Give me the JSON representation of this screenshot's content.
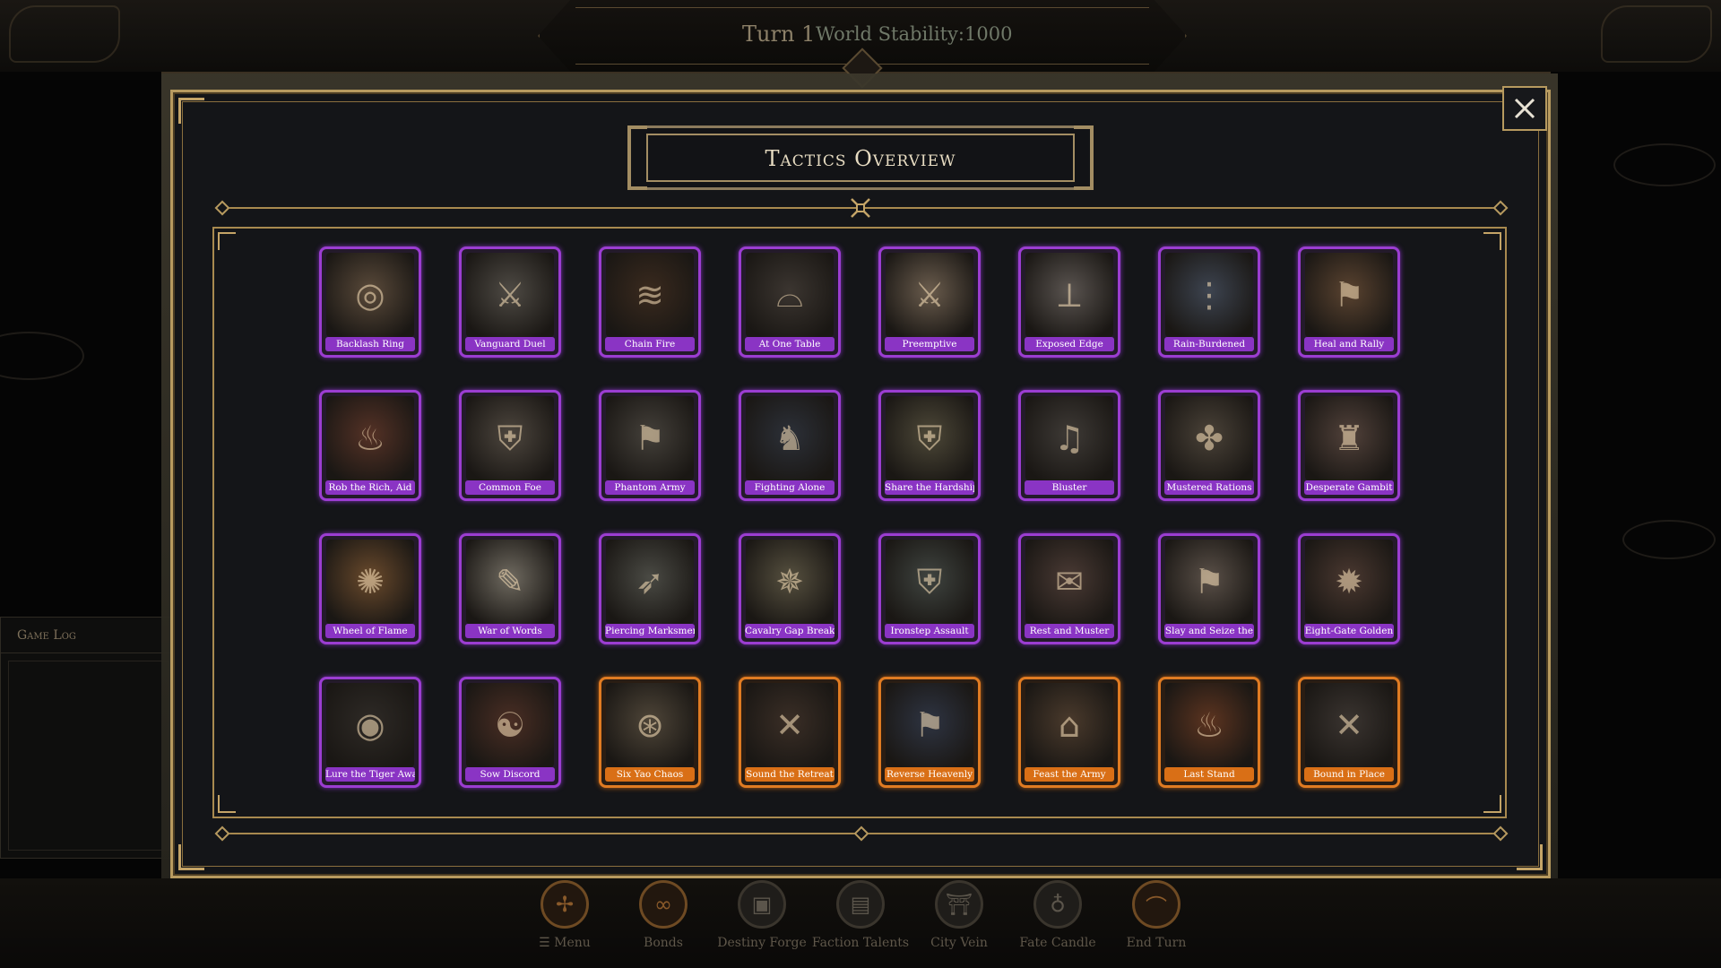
{
  "header": {
    "turn": "Turn 1",
    "stability": "World Stability:1000"
  },
  "game_log": {
    "title": "Game Log"
  },
  "modal": {
    "title": "Tactics Overview",
    "close_icon": "close-icon"
  },
  "colors": {
    "rare": "#9b3dd1",
    "legendary": "#e07b22",
    "gold": "#b79a5f"
  },
  "tactics": [
    {
      "label": "Backlash Ring",
      "rarity": "purple",
      "icon": "ring-icon",
      "glyph": "◎",
      "tone": "#5a4a3a"
    },
    {
      "label": "Vanguard Duel",
      "rarity": "purple",
      "icon": "swords-icon",
      "glyph": "⚔",
      "tone": "#4e4a44"
    },
    {
      "label": "Chain Fire",
      "rarity": "purple",
      "icon": "fire-chain-icon",
      "glyph": "≋",
      "tone": "#3a2a1e"
    },
    {
      "label": "At One Table",
      "rarity": "purple",
      "icon": "cauldron-icon",
      "glyph": "⌓",
      "tone": "#3b3530"
    },
    {
      "label": "Preemptive",
      "rarity": "purple",
      "icon": "strike-icon",
      "glyph": "⚔",
      "tone": "#6a5c4d"
    },
    {
      "label": "Exposed Edge",
      "rarity": "purple",
      "icon": "blade-icon",
      "glyph": "⟂",
      "tone": "#5a5450"
    },
    {
      "label": "Rain-Burdened",
      "rarity": "purple",
      "icon": "rain-icon",
      "glyph": "⋮",
      "tone": "#3d4450"
    },
    {
      "label": "Heal and Rally",
      "rarity": "purple",
      "icon": "banner-icon",
      "glyph": "⚑",
      "tone": "#5a4330"
    },
    {
      "label": "Rob the Rich, Aid",
      "rarity": "purple",
      "icon": "lantern-icon",
      "glyph": "♨",
      "tone": "#553226"
    },
    {
      "label": "Common Foe",
      "rarity": "purple",
      "icon": "army-icon",
      "glyph": "⛨",
      "tone": "#4d463e"
    },
    {
      "label": "Phantom Army",
      "rarity": "purple",
      "icon": "flags-icon",
      "glyph": "⚑",
      "tone": "#44403a"
    },
    {
      "label": "Fighting Alone",
      "rarity": "purple",
      "icon": "warrior-icon",
      "glyph": "♞",
      "tone": "#2c3038"
    },
    {
      "label": "Share the Hardship",
      "rarity": "purple",
      "icon": "soldiers-icon",
      "glyph": "⛨",
      "tone": "#4d4838"
    },
    {
      "label": "Bluster",
      "rarity": "purple",
      "icon": "horn-icon",
      "glyph": "♫",
      "tone": "#3e3a36"
    },
    {
      "label": "Mustered Rations",
      "rarity": "purple",
      "icon": "grain-icon",
      "glyph": "✤",
      "tone": "#4a4238"
    },
    {
      "label": "Desperate Gambit",
      "rarity": "purple",
      "icon": "general-icon",
      "glyph": "♜",
      "tone": "#51413a"
    },
    {
      "label": "Wheel of Flame",
      "rarity": "purple",
      "icon": "flame-icon",
      "glyph": "✺",
      "tone": "#6a4a2c"
    },
    {
      "label": "War of Words",
      "rarity": "purple",
      "icon": "scholar-icon",
      "glyph": "✎",
      "tone": "#6f6a60"
    },
    {
      "label": "Piercing Marksmen",
      "rarity": "purple",
      "icon": "bow-icon",
      "glyph": "➶",
      "tone": "#4a4a44"
    },
    {
      "label": "Cavalry Gap Breaker",
      "rarity": "purple",
      "icon": "cavalry-icon",
      "glyph": "✵",
      "tone": "#56503f"
    },
    {
      "label": "Ironstep Assault",
      "rarity": "purple",
      "icon": "phalanx-icon",
      "glyph": "⛨",
      "tone": "#3f4440"
    },
    {
      "label": "Rest and Muster",
      "rarity": "purple",
      "icon": "scroll-icon",
      "glyph": "✉",
      "tone": "#4a3a34"
    },
    {
      "label": "Slay and Seize the",
      "rarity": "purple",
      "icon": "spear-icon",
      "glyph": "⚑",
      "tone": "#5a5048"
    },
    {
      "label": "Eight-Gate Golden",
      "rarity": "purple",
      "icon": "formation-icon",
      "glyph": "✹",
      "tone": "#4a3830"
    },
    {
      "label": "Lure the Tiger Away",
      "rarity": "purple",
      "icon": "bells-icon",
      "glyph": "◉",
      "tone": "#2e2a26"
    },
    {
      "label": "Sow Discord",
      "rarity": "purple",
      "icon": "whisper-icon",
      "glyph": "☯",
      "tone": "#4a2e24"
    },
    {
      "label": "Six Yao Chaos",
      "rarity": "orange",
      "icon": "coins-icon",
      "glyph": "⊛",
      "tone": "#4e4538"
    },
    {
      "label": "Sound the Retreat",
      "rarity": "orange",
      "icon": "crossed-swords-icon",
      "glyph": "✕",
      "tone": "#3a2e26"
    },
    {
      "label": "Reverse Heavenly",
      "rarity": "orange",
      "icon": "storm-banner-icon",
      "glyph": "⚑",
      "tone": "#2e3442"
    },
    {
      "label": "Feast the Army",
      "rarity": "orange",
      "icon": "barrels-icon",
      "glyph": "⌂",
      "tone": "#4a3a2c"
    },
    {
      "label": "Last Stand",
      "rarity": "orange",
      "icon": "burning-army-icon",
      "glyph": "♨",
      "tone": "#5c3420"
    },
    {
      "label": "Bound in Place",
      "rarity": "orange",
      "icon": "chained-swords-icon",
      "glyph": "✕",
      "tone": "#3a3430"
    }
  ],
  "nav": [
    {
      "label": "☰ Menu",
      "icon": "compass-icon",
      "glyph": "✢",
      "active": true
    },
    {
      "label": "Bonds",
      "icon": "knot-icon",
      "glyph": "∞",
      "active": true
    },
    {
      "label": "Destiny Forge",
      "icon": "anvil-icon",
      "glyph": "▣",
      "active": false
    },
    {
      "label": "Faction Talents",
      "icon": "book-icon",
      "glyph": "▤",
      "active": false
    },
    {
      "label": "City Vein",
      "icon": "gate-icon",
      "glyph": "⛩",
      "active": false
    },
    {
      "label": "Fate Candle",
      "icon": "candle-icon",
      "glyph": "♁",
      "active": false
    },
    {
      "label": "End Turn",
      "icon": "arc-icon",
      "glyph": "⌒",
      "active": true
    }
  ]
}
